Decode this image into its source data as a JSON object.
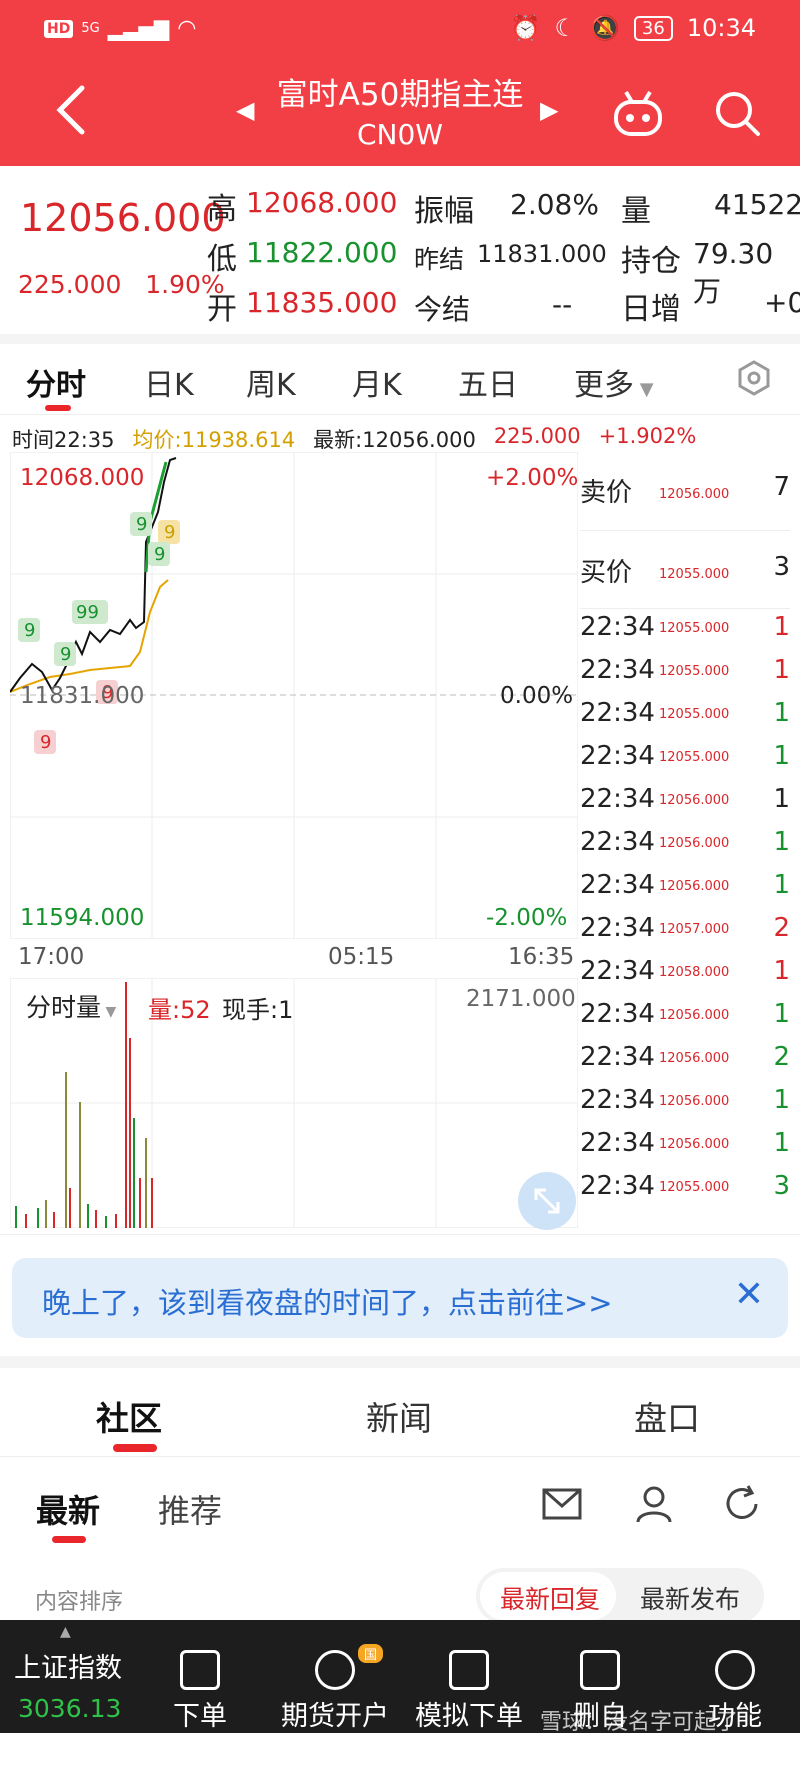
{
  "status_bar": {
    "left_icons": [
      "HD",
      "5G"
    ],
    "battery": "36",
    "time": "10:34"
  },
  "header": {
    "title": "富时A50期指主连",
    "code": "CN0W"
  },
  "quote": {
    "last": "12056.000",
    "change": "225.000",
    "change_pct": "1.90%",
    "high_label": "高",
    "high": "12068.000",
    "low_label": "低",
    "low": "11822.000",
    "open_label": "开",
    "open": "11835.000",
    "amp_label": "振幅",
    "amp": "2.08%",
    "prev_settle_label": "昨结",
    "prev_settle": "11831.000",
    "settle_label": "今结",
    "settle": "--",
    "vol_label": "量",
    "vol": "41522",
    "oi_label": "持仓",
    "oi": "79.30万",
    "daily_inc_label": "日增",
    "daily_inc": "+0"
  },
  "tabs": [
    "分时",
    "日K",
    "周K",
    "月K",
    "五日",
    "更多"
  ],
  "chart_info": {
    "time": "时间22:35",
    "avg": "均价:11938.614",
    "latest": "最新:12056.000",
    "chg": "225.000",
    "pct": "+1.902%"
  },
  "chart_labels": {
    "top_price": "12068.000",
    "top_pct": "+2.00%",
    "mid_price": "11831.000",
    "mid_pct": "0.00%",
    "bottom_price": "11594.000",
    "bottom_pct": "-2.00%",
    "time_ticks": [
      "17:00",
      "05:15",
      "16:35"
    ]
  },
  "volume_panel": {
    "label": "分时量",
    "vol": "量:52",
    "hand": "现手:1",
    "max": "2171.000"
  },
  "order_book": {
    "sell_label": "卖价",
    "sell_price": "12056.000",
    "sell_qty": "7",
    "buy_label": "买价",
    "buy_price": "12055.000",
    "buy_qty": "3"
  },
  "ticks": [
    {
      "t": "22:34",
      "p": "12055.000",
      "q": "1",
      "c": "red"
    },
    {
      "t": "22:34",
      "p": "12055.000",
      "q": "1",
      "c": "red"
    },
    {
      "t": "22:34",
      "p": "12055.000",
      "q": "1",
      "c": "green"
    },
    {
      "t": "22:34",
      "p": "12055.000",
      "q": "1",
      "c": "green"
    },
    {
      "t": "22:34",
      "p": "12056.000",
      "q": "1",
      "c": "dark"
    },
    {
      "t": "22:34",
      "p": "12056.000",
      "q": "1",
      "c": "green"
    },
    {
      "t": "22:34",
      "p": "12056.000",
      "q": "1",
      "c": "green"
    },
    {
      "t": "22:34",
      "p": "12057.000",
      "q": "2",
      "c": "red"
    },
    {
      "t": "22:34",
      "p": "12058.000",
      "q": "1",
      "c": "red"
    },
    {
      "t": "22:34",
      "p": "12056.000",
      "q": "1",
      "c": "green"
    },
    {
      "t": "22:34",
      "p": "12056.000",
      "q": "2",
      "c": "green"
    },
    {
      "t": "22:34",
      "p": "12056.000",
      "q": "1",
      "c": "green"
    },
    {
      "t": "22:34",
      "p": "12056.000",
      "q": "1",
      "c": "green"
    },
    {
      "t": "22:34",
      "p": "12055.000",
      "q": "3",
      "c": "green"
    }
  ],
  "banner": {
    "text": "晚上了，该到看夜盘的时间了，点击前往>>"
  },
  "sections": [
    "社区",
    "新闻",
    "盘口"
  ],
  "sub_tabs": [
    "最新",
    "推荐"
  ],
  "sort": {
    "label": "内容排序",
    "options": [
      "最新回复",
      "最新发布"
    ]
  },
  "bottom_bar": {
    "index_name": "上证指数",
    "index_value": "3036.13",
    "items": [
      "下单",
      "期货开户",
      "模拟下单",
      "删自选",
      "功能"
    ],
    "badge": "国",
    "watermark": "雪球：没名字可起了"
  },
  "colors": {
    "header": "#f23f45",
    "up": "#d9262b",
    "down": "#17922e",
    "avg_line": "#e5a400"
  }
}
